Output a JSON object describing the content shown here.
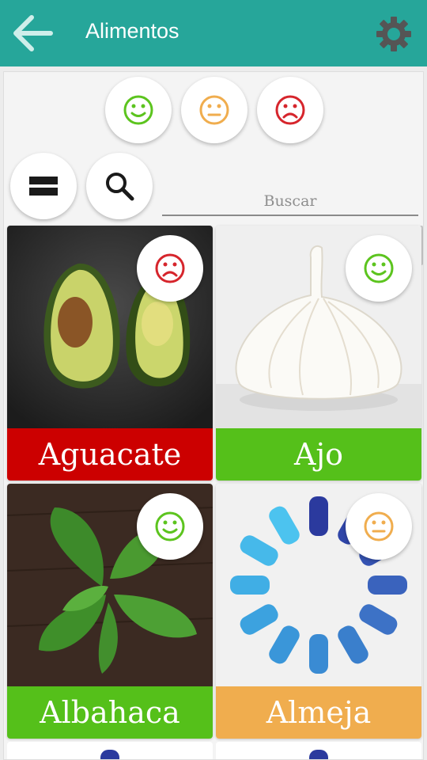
{
  "appbar": {
    "title": "Alimentos",
    "back_icon": "arrow-left-icon",
    "settings_icon": "gear-icon",
    "color": "#26a69a"
  },
  "filters": {
    "faces": [
      {
        "icon": "happy-face-icon",
        "color": "#5cc41e"
      },
      {
        "icon": "neutral-face-icon",
        "color": "#f0ad4e"
      },
      {
        "icon": "sad-face-icon",
        "color": "#d6252c"
      }
    ],
    "view_toggle_icon": "list-view-icon",
    "search_icon": "search-icon"
  },
  "search": {
    "placeholder": "Buscar",
    "value": ""
  },
  "foods": [
    {
      "name": "Aguacate",
      "rating": "sad",
      "bar_color": "#cc0000"
    },
    {
      "name": "Ajo",
      "rating": "happy",
      "bar_color": "#55c01a"
    },
    {
      "name": "Albahaca",
      "rating": "happy",
      "bar_color": "#55c01a"
    },
    {
      "name": "Almeja",
      "rating": "neutral",
      "bar_color": "#f0ad4e"
    }
  ]
}
